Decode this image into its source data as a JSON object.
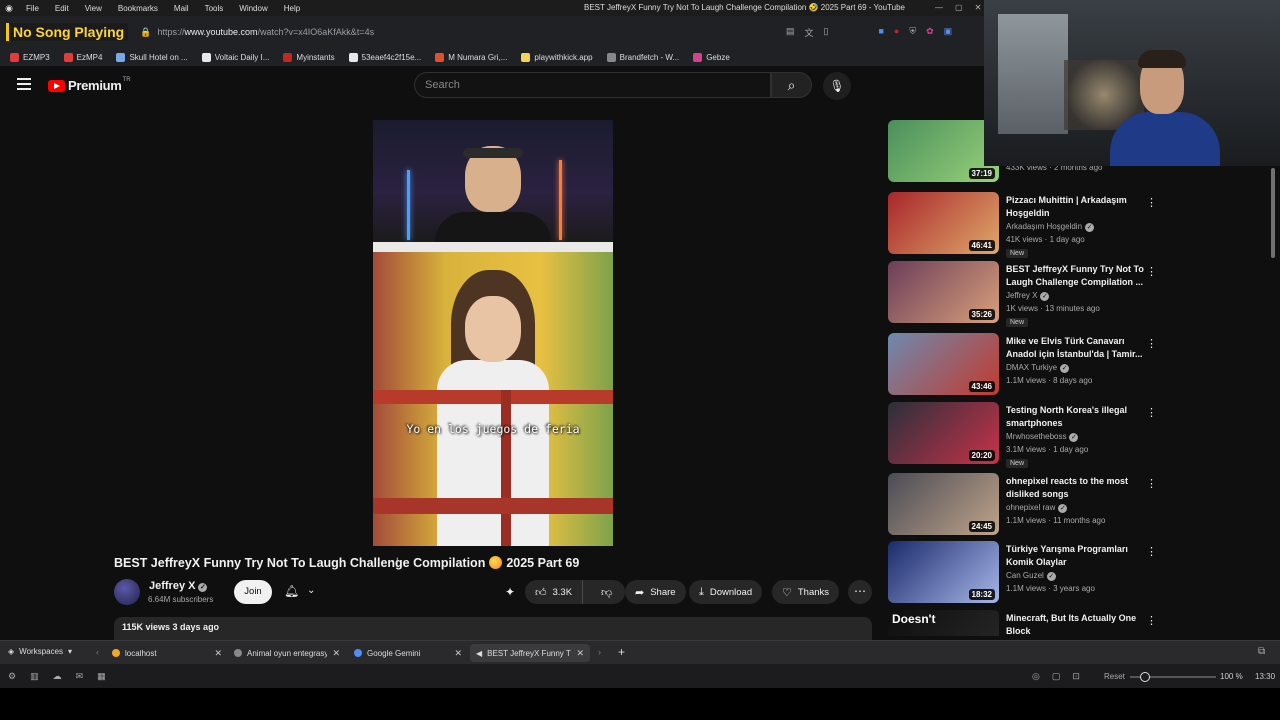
{
  "menubar": {
    "items": [
      "File",
      "Edit",
      "View",
      "Bookmarks",
      "Mail",
      "Tools",
      "Window",
      "Help"
    ],
    "window_title": "BEST JeffreyX Funny Try Not To Laugh Challenge Compilation 🤣 2025 Part 69 - YouTube"
  },
  "addressbar": {
    "song_badge": "No Song Playing",
    "url_prefix": "https://",
    "url_host": "www.youtube.com",
    "url_path": "/watch?v=x4IO6aKfAkk&t=4s"
  },
  "bookmarks": [
    {
      "label": "EZMP3",
      "color": "#e23b3b"
    },
    {
      "label": "EzMP4",
      "color": "#e23b3b"
    },
    {
      "label": "Skull Hotel on ...",
      "color": "#7aa9e8"
    },
    {
      "label": "Voltaic Daily I...",
      "color": "#e8e8e8"
    },
    {
      "label": "Myinstants",
      "color": "#c2281f"
    },
    {
      "label": "53eaef4c2f15e...",
      "color": "#e8e8e8"
    },
    {
      "label": "M Numara Gri,...",
      "color": "#e04f2f"
    },
    {
      "label": "playwithkick.app",
      "color": "#f5d35b"
    },
    {
      "label": "Brandfetch - W...",
      "color": "#888888"
    },
    {
      "label": "Gebze",
      "color": "#d4418e"
    }
  ],
  "yt": {
    "brand": "Premium",
    "region": "TR",
    "search_placeholder": "Search"
  },
  "video": {
    "subtitle": "Yo en los juegos de feria",
    "title_part1": "BEST JeffreyX Funny Try Not To Laugh Challenge Compilation",
    "title_part2": "2025 Part 69",
    "channel_name": "Jeffrey X",
    "subscribers": "6.64M subscribers",
    "join_label": "Join",
    "likes": "3.3K",
    "share_label": "Share",
    "download_label": "Download",
    "thanks_label": "Thanks",
    "views_date": "115K views  3 days ago"
  },
  "recommendations": [
    {
      "title": "",
      "channel": "",
      "meta": "433K views · 2 months ago",
      "duration": "37:19",
      "is_new": false,
      "thumb_colors": [
        "#4a8f5c",
        "#9ad27a"
      ]
    },
    {
      "title": "Pizzacı Muhittin | Arkadaşım Hoşgeldin",
      "channel": "Arkadaşım Hoşgeldin",
      "meta": "41K views · 1 day ago",
      "duration": "46:41",
      "is_new": true,
      "new_label": "New",
      "thumb_colors": [
        "#a8262b",
        "#e0a86a"
      ]
    },
    {
      "title": "BEST JeffreyX Funny Try Not To Laugh Challenge Compilation ...",
      "channel": "Jeffrey X",
      "meta": "1K views · 13 minutes ago",
      "duration": "35:26",
      "is_new": true,
      "new_label": "New",
      "thumb_colors": [
        "#6b3d5a",
        "#d9a07a"
      ]
    },
    {
      "title": "Mike ve Elvis Türk Canavarı Anadol için İstanbul'da | Tamir...",
      "channel": "DMAX Turkiye",
      "meta": "1.1M views · 8 days ago",
      "duration": "43:46",
      "is_new": false,
      "thumb_colors": [
        "#6d8ab0",
        "#c23a2e"
      ]
    },
    {
      "title": "Testing North Korea's illegal smartphones",
      "channel": "Mrwhosetheboss",
      "meta": "3.1M views · 1 day ago",
      "duration": "20:20",
      "is_new": true,
      "new_label": "New",
      "thumb_colors": [
        "#2a2f3a",
        "#c8324a"
      ]
    },
    {
      "title": "ohnepixel reacts to the most disliked songs",
      "channel": "ohnepixel raw",
      "meta": "1.1M views · 11 months ago",
      "duration": "24:45",
      "is_new": false,
      "thumb_colors": [
        "#4b4b55",
        "#bfa48a"
      ]
    },
    {
      "title": "Türkiye Yarışma Programları Komik Olaylar",
      "channel": "Can Guzel",
      "meta": "1.1M views · 3 years ago",
      "duration": "18:32",
      "is_new": false,
      "thumb_colors": [
        "#1b2a6b",
        "#a7b6e8"
      ]
    },
    {
      "title": "Minecraft, But Its Actually One Block",
      "channel": "",
      "meta": "",
      "duration": "",
      "is_new": false,
      "thumb_colors": [
        "#0e0e0e",
        "#2a2a2a"
      ],
      "thumb_text": "Doesn't"
    }
  ],
  "tabs": {
    "workspaces_label": "Workspaces",
    "items": [
      {
        "label": "localhost",
        "color": "#f5a623"
      },
      {
        "label": "Animal oyun entegrasy",
        "color": "#888888"
      },
      {
        "label": "Google Gemini",
        "color": "#4f8ef7"
      },
      {
        "label": "BEST JeffreyX Funny Tr",
        "color": "#ff0000"
      }
    ]
  },
  "status": {
    "reset_label": "Reset",
    "zoom": "100 %",
    "zoom_level": 0.17,
    "clock": "13:30"
  }
}
